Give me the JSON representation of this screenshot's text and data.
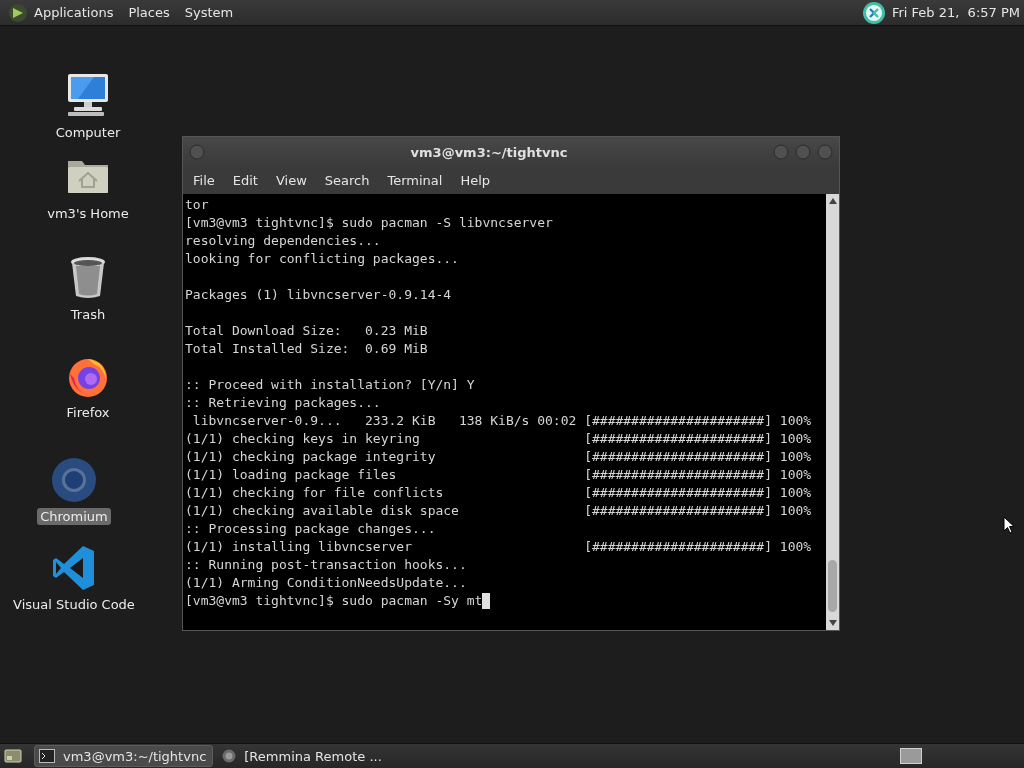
{
  "top_panel": {
    "menus": [
      {
        "label": "Applications"
      },
      {
        "label": "Places"
      },
      {
        "label": "System"
      }
    ],
    "clock": "Fri Feb 21,  6:57 PM"
  },
  "desktop_icons": [
    {
      "kind": "computer",
      "label": "Computer",
      "selected": false
    },
    {
      "kind": "home",
      "label": "vm3's Home",
      "selected": false
    },
    {
      "kind": "trash",
      "label": "Trash",
      "selected": false
    },
    {
      "kind": "firefox",
      "label": "Firefox",
      "selected": false
    },
    {
      "kind": "chromium",
      "label": "Chromium",
      "selected": true
    },
    {
      "kind": "vscode",
      "label": "Visual Studio Code",
      "selected": false
    }
  ],
  "terminal": {
    "title": "vm3@vm3:~/tightvnc",
    "menus": [
      {
        "label": "File"
      },
      {
        "label": "Edit"
      },
      {
        "label": "View"
      },
      {
        "label": "Search"
      },
      {
        "label": "Terminal"
      },
      {
        "label": "Help"
      }
    ],
    "lines": [
      {
        "kind": "text",
        "text": "tor"
      },
      {
        "kind": "text",
        "text": "[vm3@vm3 tightvnc]$ sudo pacman -S libvncserver"
      },
      {
        "kind": "text",
        "text": "resolving dependencies..."
      },
      {
        "kind": "text",
        "text": "looking for conflicting packages..."
      },
      {
        "kind": "blank"
      },
      {
        "kind": "text",
        "text": "Packages (1) libvncserver-0.9.14-4"
      },
      {
        "kind": "blank"
      },
      {
        "kind": "text",
        "text": "Total Download Size:   0.23 MiB"
      },
      {
        "kind": "text",
        "text": "Total Installed Size:  0.69 MiB"
      },
      {
        "kind": "blank"
      },
      {
        "kind": "text",
        "text": ":: Proceed with installation? [Y/n] Y"
      },
      {
        "kind": "text",
        "text": ":: Retrieving packages..."
      },
      {
        "kind": "progress",
        "text": " libvncserver-0.9...   233.2 KiB   138 KiB/s 00:02",
        "bar": "[######################]",
        "percent": "100%"
      },
      {
        "kind": "progress",
        "text": "(1/1) checking keys in keyring",
        "bar": "[######################]",
        "percent": "100%"
      },
      {
        "kind": "progress",
        "text": "(1/1) checking package integrity",
        "bar": "[######################]",
        "percent": "100%"
      },
      {
        "kind": "progress",
        "text": "(1/1) loading package files",
        "bar": "[######################]",
        "percent": "100%"
      },
      {
        "kind": "progress",
        "text": "(1/1) checking for file conflicts",
        "bar": "[######################]",
        "percent": "100%"
      },
      {
        "kind": "progress",
        "text": "(1/1) checking available disk space",
        "bar": "[######################]",
        "percent": "100%"
      },
      {
        "kind": "text",
        "text": ":: Processing package changes..."
      },
      {
        "kind": "progress",
        "text": "(1/1) installing libvncserver",
        "bar": "[######################]",
        "percent": "100%"
      },
      {
        "kind": "text",
        "text": ":: Running post-transaction hooks..."
      },
      {
        "kind": "text",
        "text": "(1/1) Arming ConditionNeedsUpdate..."
      },
      {
        "kind": "text",
        "text": "[vm3@vm3 tightvnc]$ sudo pacman -Sy mt",
        "cursor": true
      }
    ]
  },
  "taskbar": {
    "tasks": [
      {
        "label": "vm3@vm3:~/tightvnc",
        "kind": "terminal",
        "selected": true
      },
      {
        "label": "[Remmina Remote ...",
        "kind": "remmina",
        "selected": false
      }
    ]
  }
}
